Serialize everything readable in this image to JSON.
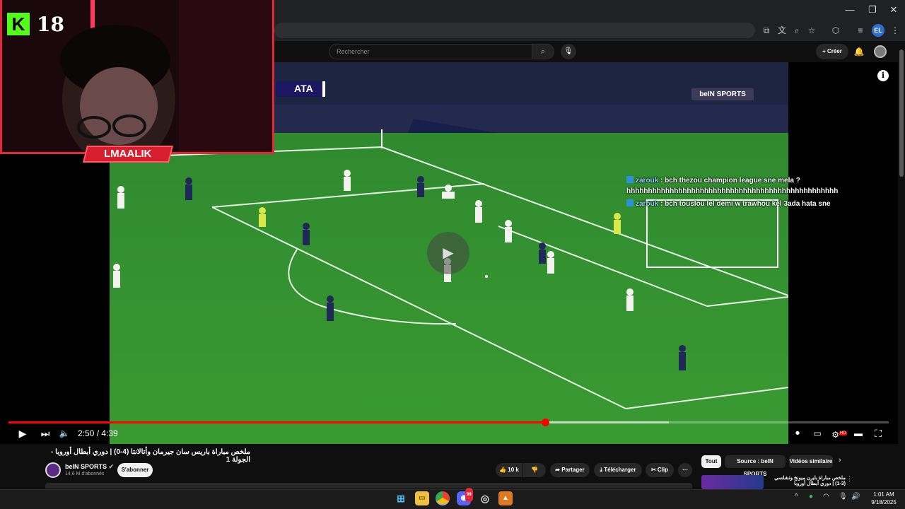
{
  "webcam": {
    "viewer_count": "18",
    "streamer_name": "LMAALIK",
    "platform_logo": "K"
  },
  "youtube": {
    "search_placeholder": "Rechercher",
    "create_label": "Créer"
  },
  "browser": {
    "profile_initials": "EL"
  },
  "video": {
    "scorebug_team": "ATA",
    "broadcaster_left": "beIN",
    "broadcaster_right": "SPORTS",
    "time_display": "2:50 / 4:39",
    "progress_fraction": 0.61,
    "buffer_fraction": 0.75,
    "title": "ملخص مباراة باريس سان جيرمان وأتالانتا (4-0) | دوري أبطال أوروبا - الجولة 1",
    "hd_badge": "HD"
  },
  "chat": [
    {
      "user": "zarouk",
      "message": " : bch thezou champion league sne mela ?"
    },
    {
      "user": "",
      "message": "hhhhhhhhhhhhhhhhhhhhhhhhhhhhhhhhhhhhhhhhhhhhhhhhh"
    },
    {
      "user": "zarouk",
      "message": " : bch touslou lel demi w trawhou kel 3ada hata sne"
    }
  ],
  "channel": {
    "name": "beIN SPORTS",
    "subscribers": "14,6 M d'abonnés",
    "subscribe_label": "S'abonner"
  },
  "actions": {
    "likes": "10 k",
    "share": "Partager",
    "download": "Télécharger",
    "clip": "Clip"
  },
  "chips": {
    "all": "Tout",
    "source": "Source : beIN SPORTS",
    "similar": "Vidéos similaire"
  },
  "related": {
    "title": "ملخص مباراة بايرن ميونخ وتشلسي (3-1) | دوري أبطال أوروبا"
  },
  "taskbar": {
    "time": "1:01 AM",
    "date": "9/18/2025",
    "discord_badge": "99"
  },
  "icons": [
    "search-icon",
    "mic-icon",
    "plus-icon",
    "bell-icon",
    "info-icon",
    "play-icon",
    "next-icon",
    "volume-icon",
    "settings-icon",
    "fullscreen-icon"
  ]
}
